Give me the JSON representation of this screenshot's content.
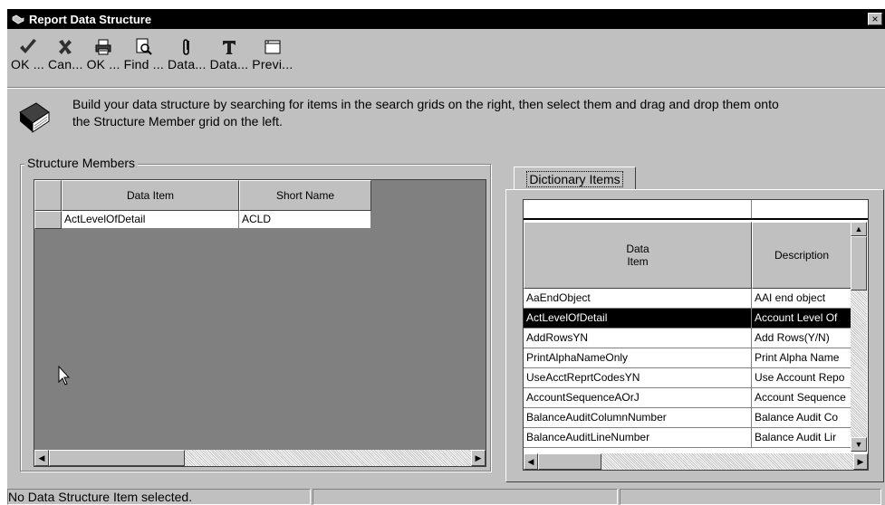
{
  "window": {
    "title": "Report Data Structure",
    "close_label": "×"
  },
  "toolbar": {
    "buttons": [
      {
        "label": "OK ...",
        "icon": "checkmark-icon"
      },
      {
        "label": "Can...",
        "icon": "x-cancel-icon"
      },
      {
        "label": "OK ...",
        "icon": "printer-icon"
      },
      {
        "label": "Find ...",
        "icon": "find-magnifier-icon"
      },
      {
        "label": "Data...",
        "icon": "paperclip-icon"
      },
      {
        "label": "Data...",
        "icon": "text-t-icon"
      },
      {
        "label": "Previ...",
        "icon": "preview-window-icon"
      }
    ]
  },
  "instructions": {
    "line1": "Build your data structure by searching for items in the search grids on the right, then select them and drag and drop them onto",
    "line2": "the Structure Member grid on the left."
  },
  "structure_members": {
    "legend": "Structure Members",
    "columns": [
      "Data Item",
      "Short Name"
    ],
    "rows": [
      {
        "data_item": "ActLevelOfDetail",
        "short_name": "ACLD"
      }
    ]
  },
  "dictionary": {
    "tab_label": "Dictionary Items",
    "columns": [
      "Data\nItem",
      "Description"
    ],
    "rows": [
      {
        "data_item": "AaEndObject",
        "description": "AAI end object",
        "selected": false
      },
      {
        "data_item": "ActLevelOfDetail",
        "description": "Account Level Of",
        "selected": true
      },
      {
        "data_item": "AddRowsYN",
        "description": "Add Rows(Y/N)",
        "selected": false
      },
      {
        "data_item": "PrintAlphaNameOnly",
        "description": "Print Alpha Name",
        "selected": false
      },
      {
        "data_item": "UseAcctReprtCodesYN",
        "description": "Use Account Repo",
        "selected": false
      },
      {
        "data_item": "AccountSequenceAOrJ",
        "description": "Account Sequence",
        "selected": false
      },
      {
        "data_item": "BalanceAuditColumnNumber",
        "description": "Balance Audit Co",
        "selected": false
      },
      {
        "data_item": "BalanceAuditLineNumber",
        "description": "Balance Audit Lir",
        "selected": false
      }
    ]
  },
  "statusbar": {
    "message": "No Data Structure Item selected.",
    "pane2": "",
    "pane3": ""
  },
  "colors": {
    "face": "#c0c0c0",
    "title_bg": "#000000",
    "grid_bg": "#808080",
    "selection_bg": "#000000"
  }
}
